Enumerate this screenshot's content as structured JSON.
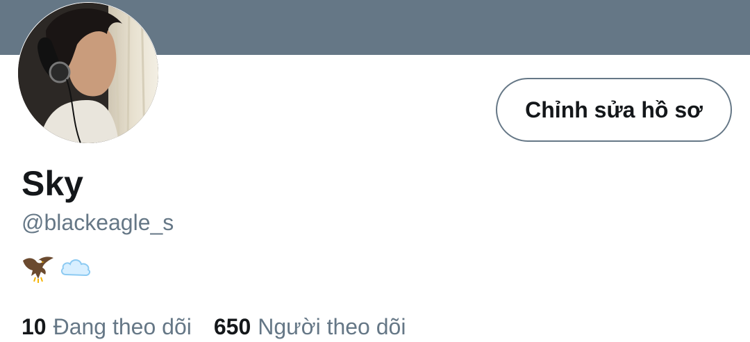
{
  "profile": {
    "name": "Sky",
    "handle": "@blackeagle_s",
    "edit_button_label": "Chỉnh sửa hồ sơ",
    "bio_icons": [
      "eagle-icon",
      "cloud-icon"
    ]
  },
  "stats": {
    "following_count": "10",
    "following_label": "Đang theo dõi",
    "followers_count": "650",
    "followers_label": "Người theo dõi"
  },
  "colors": {
    "banner": "#657786",
    "text_primary": "#14171a",
    "text_secondary": "#657786",
    "background": "#ffffff"
  }
}
